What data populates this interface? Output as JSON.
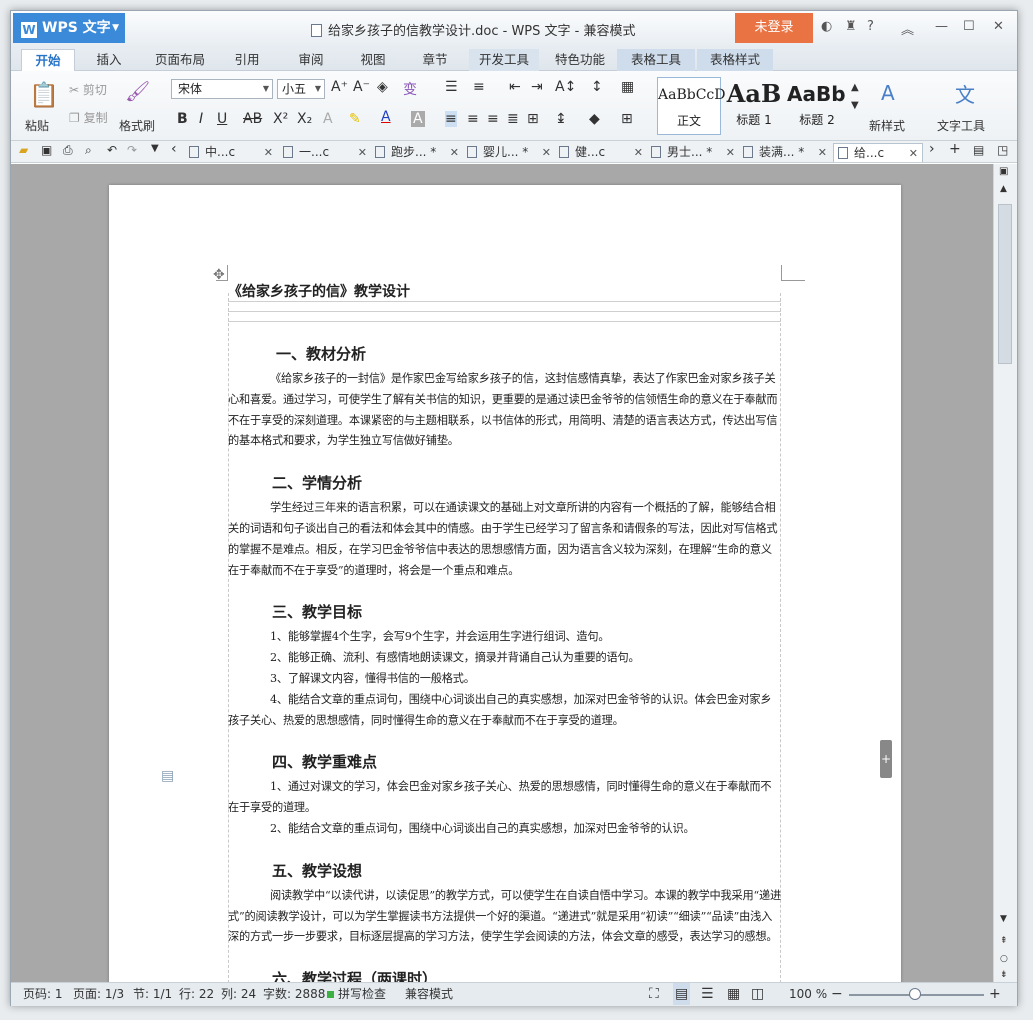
{
  "app": {
    "name": "WPS 文字",
    "title": "给家乡孩子的信教学设计.doc - WPS 文字 - 兼容模式",
    "login": "未登录"
  },
  "tabs": [
    "开始",
    "插入",
    "页面布局",
    "引用",
    "审阅",
    "视图",
    "章节",
    "开发工具",
    "特色功能",
    "表格工具",
    "表格样式"
  ],
  "ribbon": {
    "paste": "粘贴",
    "cut": "剪切",
    "copy": "复制",
    "format_painter": "格式刷",
    "font": "宋体",
    "size": "小五",
    "style1_preview": "AaBbCcD",
    "style1": "正文",
    "style2_preview": "AaB",
    "style2": "标题 1",
    "style3_preview": "AaBb(",
    "style3": "标题 2",
    "new_style": "新样式",
    "text_tools": "文字工具"
  },
  "doc_tabs": [
    "中...c",
    "一...c",
    "跑步... *",
    "婴儿... *",
    "健...c",
    "男士... *",
    "装满... *",
    "给...c"
  ],
  "document": {
    "header": "《给家乡孩子的信》教学设计",
    "sections": [
      {
        "title": "一、教材分析",
        "paras": [
          "《给家乡孩子的一封信》是作家巴金写给家乡孩子的信，这封信感情真挚，表达了作家巴金对家乡孩子关心和喜爱。通过学习，可使学生了解有关书信的知识，更重要的是通过读巴金爷爷的信领悟生命的意义在于奉献而不在于享受的深刻道理。本课紧密的与主题相联系，以书信体的形式，用简明、清楚的语言表达方式，传达出写信的基本格式和要求，为学生独立写信做好铺垫。"
        ]
      },
      {
        "title": "二、学情分析",
        "paras": [
          "学生经过三年来的语言积累，可以在通读课文的基础上对文章所讲的内容有一个概括的了解，能够结合相关的词语和句子谈出自己的看法和体会其中的情感。由于学生已经学习了留言条和请假条的写法，因此对写信格式的掌握不是难点。相反，在学习巴金爷爷信中表达的思想感情方面，因为语言含义较为深刻，在理解“生命的意义在于奉献而不在于享受”的道理时，将会是一个重点和难点。"
        ]
      },
      {
        "title": "三、教学目标",
        "paras": [
          "1、能够掌握4个生字，会写9个生字，并会运用生字进行组词、造句。",
          "2、能够正确、流利、有感情地朗读课文，摘录并背诵自己认为重要的语句。",
          "3、了解课文内容，懂得书信的一般格式。",
          "4、能结合文章的重点词句，围绕中心词谈出自己的真实感想，加深对巴金爷爷的认识。体会巴金对家乡孩子关心、热爱的思想感情，同时懂得生命的意义在于奉献而不在于享受的道理。"
        ]
      },
      {
        "title": "四、教学重难点",
        "paras": [
          "1、通过对课文的学习，体会巴金对家乡孩子关心、热爱的思想感情，同时懂得生命的意义在于奉献而不在于享受的道理。",
          "2、能结合文章的重点词句，围绕中心词谈出自己的真实感想，加深对巴金爷爷的认识。"
        ]
      },
      {
        "title": "五、教学设想",
        "paras": [
          "阅读教学中“以读代讲，以读促思”的教学方式，可以使学生在自读自悟中学习。本课的教学中我采用“递进式”的阅读教学设计，可以为学生掌握读书方法提供一个好的渠道。“递进式”就是采用“初读”“细读”“品读”由浅入深的方式一步一步要求，目标逐层提高的学习方法，使学生学会阅读的方法，体会文章的感受，表达学习的感想。"
        ]
      },
      {
        "title": "六、教学过程（两课时）",
        "paras": []
      }
    ]
  },
  "status": {
    "page": "页码: 1",
    "pages": "页面: 1/3",
    "section": "节: 1/1",
    "row": "行: 22",
    "col": "列: 24",
    "words": "字数: 2888",
    "spell": "拼写检查",
    "mode": "兼容模式",
    "zoom": "100 %"
  }
}
